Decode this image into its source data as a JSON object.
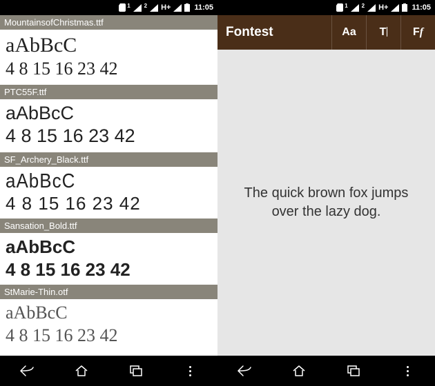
{
  "status": {
    "network_label": "H+",
    "time": "11:05",
    "sim1_label": "1",
    "sim2_label": "2"
  },
  "left": {
    "fonts": [
      {
        "file": "MountainsofChristmas.ttf",
        "letters": "aAbBcC",
        "numbers": "4 8 15 16 23 42",
        "style": "f-mountains"
      },
      {
        "file": "PTC55F.ttf",
        "letters": "aAbBcC",
        "numbers": "4 8 15 16 23 42",
        "style": "f-ptc"
      },
      {
        "file": "SF_Archery_Black.ttf",
        "letters": "aAbBcC",
        "numbers": "4 8 15 16 23 42",
        "style": "f-archery"
      },
      {
        "file": "Sansation_Bold.ttf",
        "letters": "aAbBcC",
        "numbers": "4 8 15 16 23 42",
        "style": "f-sansation"
      },
      {
        "file": "StMarie-Thin.otf",
        "letters": "aAbBcC",
        "numbers": "4 8 15 16 23 42",
        "style": "f-stmarie"
      }
    ]
  },
  "right": {
    "app_title": "Fontest",
    "action_aa": "Aa",
    "action_t": "T",
    "action_ff_1": "F",
    "action_ff_2": "f",
    "preview": "The quick brown fox jumps over the lazy dog."
  },
  "icons": {
    "back": "back-icon",
    "home": "home-icon",
    "recent": "recent-icon",
    "menu_dots": "menu-dots-icon",
    "card": "sim-card-icon",
    "signal": "signal-icon",
    "battery": "battery-icon",
    "cursor": "text-cursor-icon"
  }
}
